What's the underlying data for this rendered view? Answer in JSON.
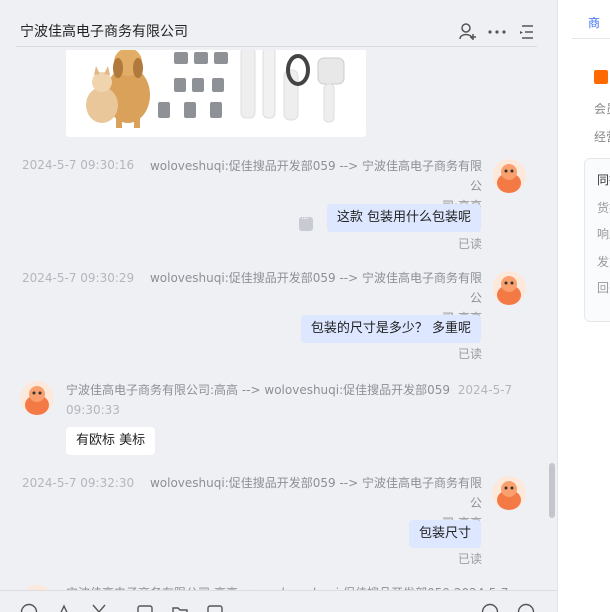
{
  "chat": {
    "title": "宁波佳高电子商务有限公司",
    "messages": [
      {
        "time": "2024-5-7 09:30:16",
        "meta_line1": "woloveshuqi:促佳搜品开发部059 --> 宁波佳高电子商务有限公",
        "meta_line2": "司:高高",
        "text": "这款  包装用什么包装呢",
        "status": "已读"
      },
      {
        "time": "2024-5-7 09:30:29",
        "meta_line1": "woloveshuqi:促佳搜品开发部059 --> 宁波佳高电子商务有限公",
        "meta_line2": "司:高高",
        "text": "包装的尺寸是多少？  多重呢",
        "status": "已读"
      },
      {
        "meta_line1": "宁波佳高电子商务有限公司:高高 --> woloveshuqi:促佳搜品开发部059",
        "time_part1": "2024-5-7",
        "time_part2": "09:30:33",
        "text": "有欧标 美标"
      },
      {
        "time": "2024-5-7 09:32:30",
        "meta_line1": "woloveshuqi:促佳搜品开发部059 --> 宁波佳高电子商务有限公",
        "meta_line2": "司:高高",
        "text": "包装尺寸",
        "status": "已读"
      }
    ],
    "partial_meta": "宁波佳高电子商务有限公司:高高 --> woloveshuqi:促佳搜品开发部059  2024-5-7"
  },
  "icons": {
    "header": [
      "add-user-icon",
      "more-icon",
      "list-icon"
    ],
    "toolbar": [
      "emoji-icon",
      "font-icon",
      "scissors-icon",
      "image-icon",
      "folder-icon",
      "video-icon",
      "add-icon",
      "history-icon"
    ]
  },
  "side": {
    "tab": "商",
    "line1": "会员",
    "line2": "经营",
    "box_title": "同行",
    "box_items": [
      "货描",
      "响应",
      "发货",
      "回头"
    ]
  },
  "colors": {
    "my_bubble": "#dde7ff",
    "their_bubble": "#ffffff",
    "accent": "#3a6ff7",
    "avatar": "#f47a45"
  }
}
